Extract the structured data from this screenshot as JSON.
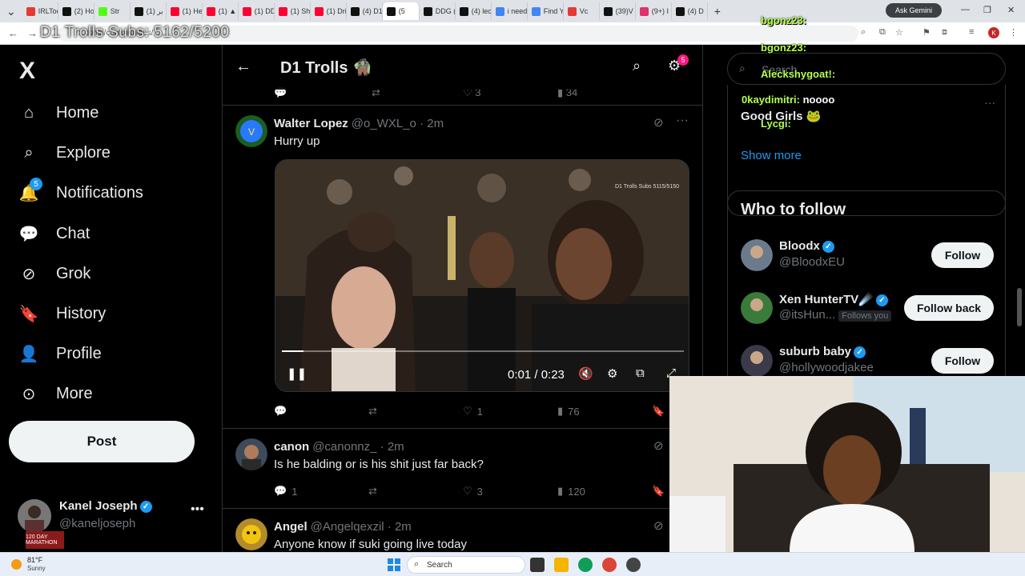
{
  "browser": {
    "tabs": [
      {
        "label": "IRLToo",
        "color": "#e53935"
      },
      {
        "label": "(2) Ho",
        "color": "#111111"
      },
      {
        "label": "Str",
        "color": "#53fc18"
      },
      {
        "label": "(1) بر",
        "color": "#111111"
      },
      {
        "label": "(1) He",
        "color": "#ff0033"
      },
      {
        "label": "(1) ▲",
        "color": "#ff0033"
      },
      {
        "label": "(1) DD",
        "color": "#ff0033"
      },
      {
        "label": "(1) Sh",
        "color": "#ff0033"
      },
      {
        "label": "(1) Dri",
        "color": "#ff0033"
      },
      {
        "label": "(4) D1",
        "color": "#111111"
      },
      {
        "label": "(5",
        "color": "#111111"
      },
      {
        "label": "DDG (",
        "color": "#111111"
      },
      {
        "label": "(4) lec",
        "color": "#111111"
      },
      {
        "label": "i need",
        "color": "#4285f4"
      },
      {
        "label": "Find Y",
        "color": "#4285f4"
      },
      {
        "label": "Vc",
        "color": "#e53935"
      },
      {
        "label": "(39)V",
        "color": "#111111"
      },
      {
        "label": "(9+) I",
        "color": "#e1306c"
      },
      {
        "label": "(4) D",
        "color": "#111111"
      }
    ],
    "active_tab_index": 10,
    "ask_gemini": "Ask Gemini",
    "url": "x.com/i/communities/1...",
    "profile_initial": "K"
  },
  "stream_overlay": {
    "subs_goal": "D1 Trolls Subs: 5162/5200",
    "chat": [
      {
        "user": "bgonz23:"
      },
      {
        "user": "bgonz23:"
      },
      {
        "user": "Aleckshygoat!:"
      },
      {
        "user": "0kaydimitri:",
        "msg": "noooo"
      },
      {
        "user": "Lycgi:"
      }
    ]
  },
  "leftnav": {
    "logo": "X",
    "items": [
      {
        "label": "Home",
        "icon": "home-icon"
      },
      {
        "label": "Explore",
        "icon": "search-icon"
      },
      {
        "label": "Notifications",
        "icon": "bell-icon",
        "badge": "5"
      },
      {
        "label": "Chat",
        "icon": "chat-icon"
      },
      {
        "label": "Grok",
        "icon": "grok-icon"
      },
      {
        "label": "History",
        "icon": "bookmark-icon"
      },
      {
        "label": "Profile",
        "icon": "person-icon"
      },
      {
        "label": "More",
        "icon": "more-circle-icon"
      }
    ],
    "post_label": "Post",
    "account": {
      "name": "Kanel Joseph",
      "handle": "@kaneljoseph",
      "tag": "120 DAY MARATHON"
    }
  },
  "main": {
    "title": "D1 Trolls 🧌",
    "settings_badge": "5",
    "prev_stats": {
      "likes": "3",
      "views": "34"
    },
    "tweets": [
      {
        "name": "Walter Lopez",
        "handle": "@o_WXL_o",
        "time": "2m",
        "text": "Hurry up",
        "replies": "",
        "retweets": "",
        "likes": "1",
        "views": "76",
        "video": {
          "tag": "D1 Trolls Subs 5115/5150",
          "time": "0:01 / 0:23",
          "progress": 0.054
        }
      },
      {
        "name": "canon",
        "handle": "@canonnz_",
        "time": "2m",
        "text": "Is he balding or is his shit just far back?",
        "replies": "1",
        "retweets": "",
        "likes": "3",
        "views": "120"
      },
      {
        "name": "Angel",
        "handle": "@Angelqexzil",
        "time": "2m",
        "text": "Anyone know if suki going live today"
      }
    ]
  },
  "right": {
    "search_placeholder": "Search",
    "trend": {
      "title": "Good Girls 🐸",
      "show_more": "Show more"
    },
    "who_to_follow": {
      "title": "Who to follow",
      "users": [
        {
          "name": "Bloodx",
          "handle": "@BloodxEU",
          "button": "Follow",
          "verified": true
        },
        {
          "name": "Xen HunterTV☄️",
          "handle": "@itsHun...",
          "follows_you": "Follows you",
          "button": "Follow back",
          "verified": true
        },
        {
          "name": "suburb baby",
          "handle": "@hollywoodjakee",
          "button": "Follow",
          "verified": true
        }
      ]
    }
  },
  "taskbar": {
    "temp": "81°F",
    "weather": "Sunny",
    "search": "Search"
  }
}
